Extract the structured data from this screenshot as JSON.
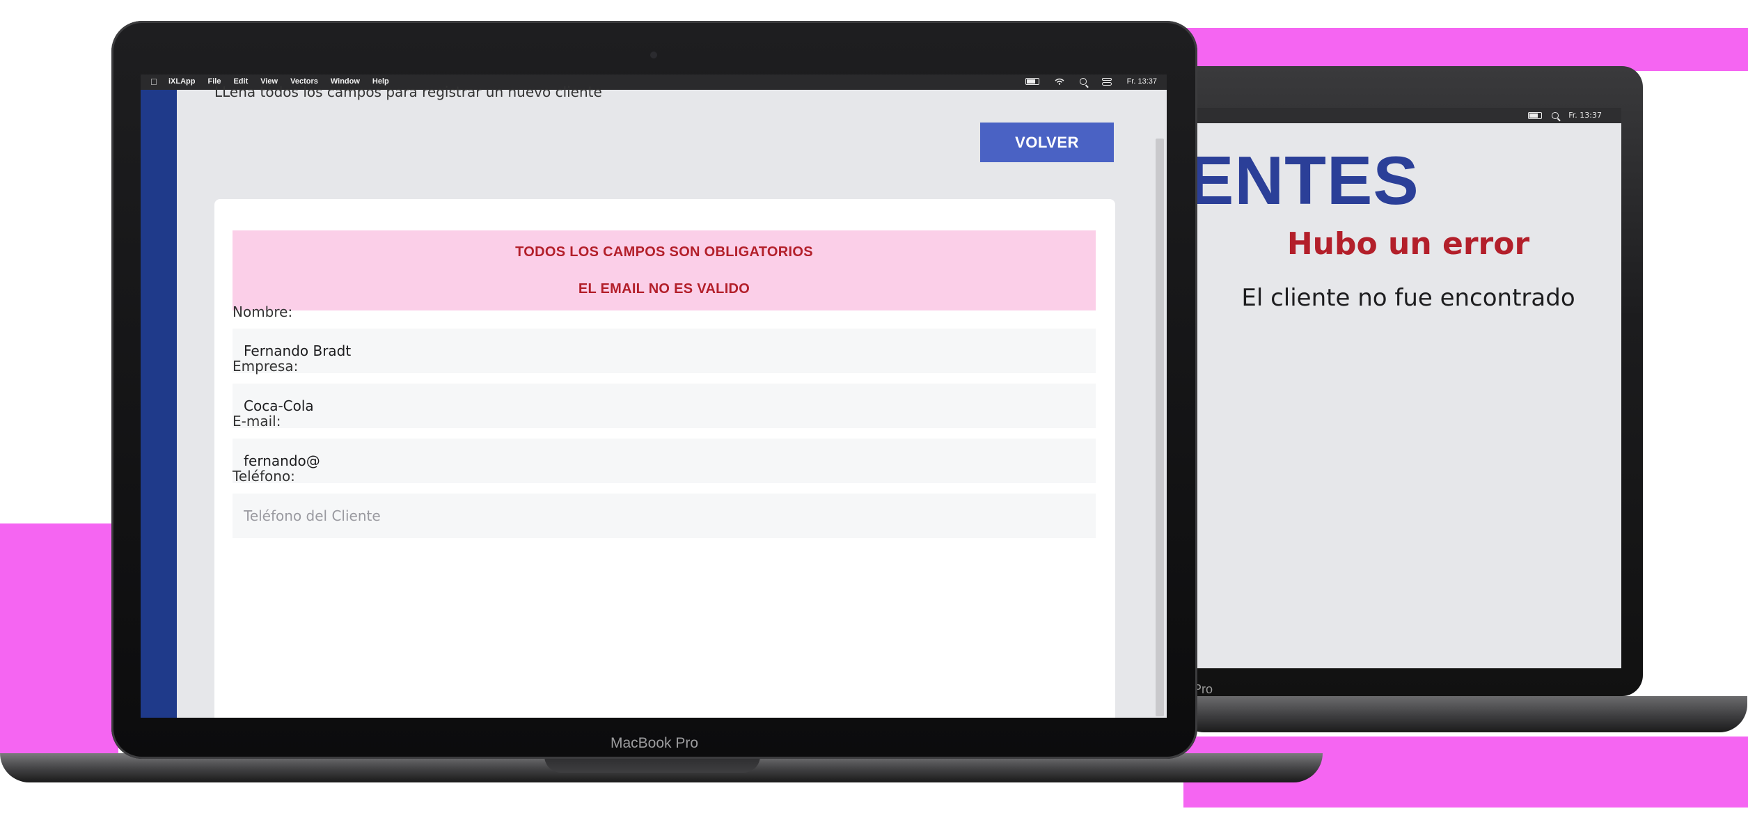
{
  "front": {
    "menubar": {
      "apple_icon": "apple-icon",
      "items": [
        "iXLApp",
        "File",
        "Edit",
        "View",
        "Vectors",
        "Window",
        "Help"
      ],
      "clock": "Fr. 13:37"
    },
    "subtitle": "LLena todos los campos para registrar un nuevo cliente",
    "back_button": "VOLVER",
    "alerts": [
      "TODOS LOS CAMPOS SON OBLIGATORIOS",
      "EL EMAIL NO ES VALIDO"
    ],
    "form": {
      "nombre_label": "Nombre:",
      "nombre_value": "Fernando Bradt",
      "empresa_label": "Empresa:",
      "empresa_value": "Coca-Cola",
      "email_label": "E-mail:",
      "email_value": "fernando@",
      "telefono_label": "Teléfono:",
      "telefono_placeholder": "Teléfono del Cliente"
    },
    "device_label": "MacBook Pro"
  },
  "back": {
    "clock": "Fr. 13:37",
    "title": "ENTES",
    "error_title": "Hubo un error",
    "error_message": "El cliente no fue encontrado",
    "device_label": "Pro"
  },
  "colors": {
    "sidebar": "#1f3a8a",
    "button": "#4a62c4",
    "alert_bg": "#fbcfe8",
    "alert_text": "#b31f2a",
    "title_blue": "#2b3f98",
    "background_accent": "#f565f2"
  }
}
